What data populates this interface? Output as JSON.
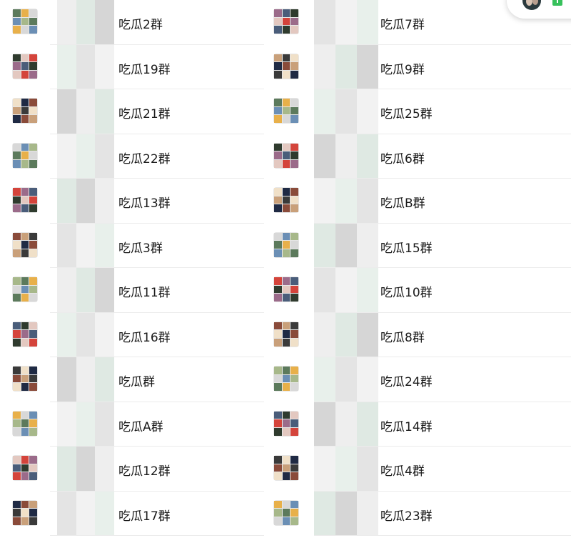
{
  "groups_left": [
    {
      "name": "吃瓜2群"
    },
    {
      "name": "吃瓜19群"
    },
    {
      "name": "吃瓜21群"
    },
    {
      "name": "吃瓜22群"
    },
    {
      "name": "吃瓜13群"
    },
    {
      "name": "吃瓜3群"
    },
    {
      "name": "吃瓜11群"
    },
    {
      "name": "吃瓜16群"
    },
    {
      "name": "吃瓜群"
    },
    {
      "name": "吃瓜A群"
    },
    {
      "name": "吃瓜12群"
    },
    {
      "name": "吃瓜17群"
    }
  ],
  "groups_right": [
    {
      "name": "吃瓜7群"
    },
    {
      "name": "吃瓜9群"
    },
    {
      "name": "吃瓜25群"
    },
    {
      "name": "吃瓜6群"
    },
    {
      "name": "吃瓜B群"
    },
    {
      "name": "吃瓜15群"
    },
    {
      "name": "吃瓜10群"
    },
    {
      "name": "吃瓜8群"
    },
    {
      "name": "吃瓜24群"
    },
    {
      "name": "吃瓜14群"
    },
    {
      "name": "吃瓜4群"
    },
    {
      "name": "吃瓜23群"
    }
  ],
  "avatar_palette": [
    "#4a5d7a",
    "#8a4b3a",
    "#d8d8d8",
    "#2f3b2e",
    "#c9a07a",
    "#6b8fb5",
    "#e3c8c0",
    "#3a3a3a",
    "#a7b88a",
    "#d4443b",
    "#f0e0c8",
    "#5c7a5c",
    "#9b6b8a",
    "#1f2a44",
    "#e8b04a"
  ],
  "blur_palette": [
    "#e4e4e4",
    "#dfe9e3",
    "#f2f2f2",
    "#d6d6d6",
    "#e8f0eb",
    "#eeeeee"
  ],
  "floating_badge": {
    "color": "#37c15c"
  }
}
